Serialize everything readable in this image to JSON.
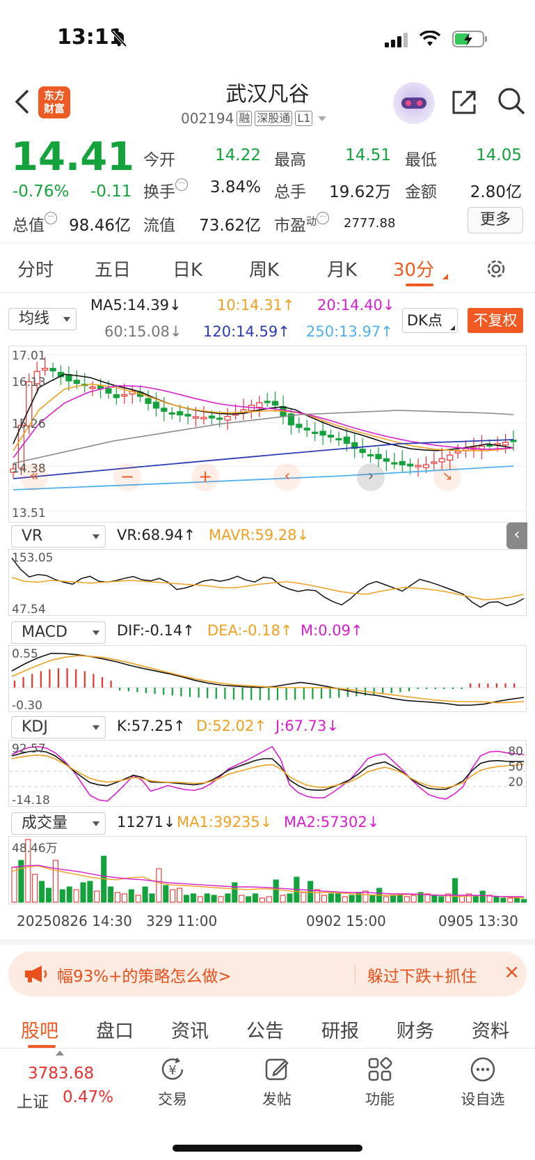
{
  "status": {
    "time": "13:11"
  },
  "header": {
    "logo_line1": "东方",
    "logo_line2": "财富",
    "title": "武汉凡谷",
    "code": "002194",
    "tag1": "融",
    "tag2": "深股通",
    "tag3": "L1"
  },
  "quote": {
    "price": "14.41",
    "change_pct": "-0.76%",
    "change": "-0.11",
    "open_label": "今开",
    "open": "14.22",
    "high_label": "最高",
    "high": "14.51",
    "low_label": "最低",
    "low": "14.05",
    "turnover_label": "换手",
    "turnover": "3.84%",
    "volume_label": "总手",
    "volume": "19.62万",
    "amount_label": "金额",
    "amount": "2.80亿",
    "mktcap_label": "总值",
    "mktcap": "98.46亿",
    "float_label": "流值",
    "float": "73.62亿",
    "pe_label": "市盈",
    "pe_sup": "动",
    "pe": "2777.88",
    "more": "更多",
    "accent": "#14a23c"
  },
  "period_tabs": [
    "分时",
    "五日",
    "日K",
    "周K",
    "月K",
    "30分"
  ],
  "ma_row": {
    "select": "均线",
    "ma5": "MA5:14.39↓",
    "ma10": "10:14.31↑",
    "ma20": "20:14.40↓",
    "ma60": "60:15.08↓",
    "ma120": "120:14.59↑",
    "ma250": "250:13.97↑",
    "dk": "DK点",
    "fuquan": "不复权"
  },
  "kline": {
    "y_labels": [
      "17.01",
      "16.13",
      "15.26",
      "14.38",
      "13.51"
    ],
    "ylim": [
      13.51,
      17.01
    ]
  },
  "vr": {
    "select": "VR",
    "vr": "VR:68.94↑",
    "mavr": "MAVR:59.28↓",
    "max": "153.05",
    "min": "47.54"
  },
  "macd": {
    "select": "MACD",
    "dif": "DIF:-0.14↑",
    "dea": "DEA:-0.18↑",
    "m": "M:0.09↑",
    "max": "0.55",
    "min": "-0.30"
  },
  "kdj": {
    "select": "KDJ",
    "k": "K:57.25↑",
    "d": "D:52.02↑",
    "j": "J:67.73↓",
    "max": "92.57",
    "min": "-14.18",
    "r80": "80",
    "r50": "50",
    "r20": "20"
  },
  "vol": {
    "select": "成交量",
    "v": "11271↓",
    "ma1": "MA1:39235↓",
    "ma2": "MA2:57302↓",
    "max": "48.46万"
  },
  "time_axis": {
    "t1": "20250826 14:30",
    "t2": "329 11:00",
    "t3": "0902 15:00",
    "t4": "0905 13:30"
  },
  "banner": {
    "text1": "幅93%+的策略怎么做>",
    "text2": "躲过下跌+抓住"
  },
  "bottom_tabs": [
    "股吧",
    "盘口",
    "资讯",
    "公告",
    "研报",
    "财务",
    "资料"
  ],
  "nav": {
    "index_value": "3783.68",
    "index_name": "上证",
    "index_pct": "0.47%",
    "trade": "交易",
    "post": "发帖",
    "func": "功能",
    "watch": "设自选"
  },
  "colors": {
    "up": "#e8322f",
    "down": "#14a23c",
    "accent": "#f05a22"
  }
}
